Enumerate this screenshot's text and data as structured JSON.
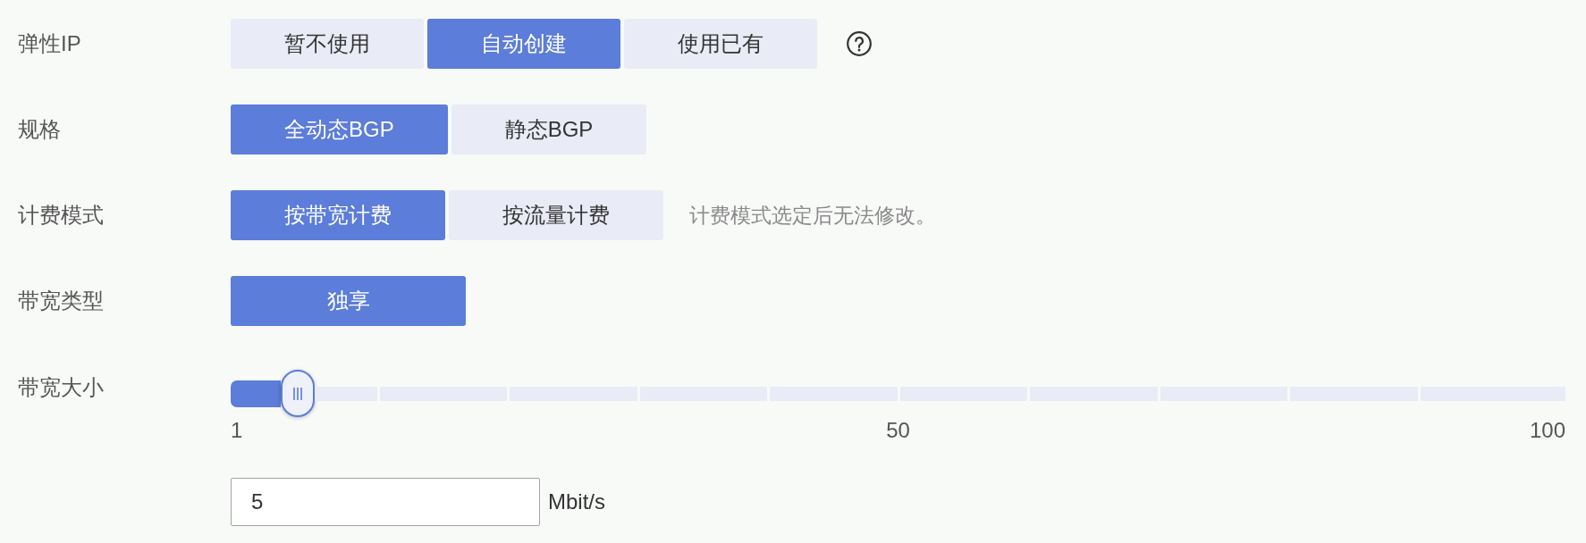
{
  "rows": [
    {
      "kind": "options",
      "label": "弹性IP",
      "options": [
        {
          "label": "暂不使用",
          "selected": false
        },
        {
          "label": "自动创建",
          "selected": true
        },
        {
          "label": "使用已有",
          "selected": false
        }
      ],
      "help": true
    },
    {
      "kind": "options",
      "label": "规格",
      "options": [
        {
          "label": "全动态BGP",
          "selected": true
        },
        {
          "label": "静态BGP",
          "selected": false
        }
      ]
    },
    {
      "kind": "options",
      "label": "计费模式",
      "options": [
        {
          "label": "按带宽计费",
          "selected": true
        },
        {
          "label": "按流量计费",
          "selected": false
        }
      ],
      "hint": "计费模式选定后无法修改。"
    },
    {
      "kind": "options",
      "label": "带宽类型",
      "options": [
        {
          "label": "独享",
          "selected": true
        }
      ]
    },
    {
      "kind": "slider",
      "label": "带宽大小",
      "level": 0.05,
      "ticks": [
        "1",
        "50",
        "100"
      ],
      "input": {
        "value": "5",
        "unit": "Mbit/s"
      }
    }
  ]
}
